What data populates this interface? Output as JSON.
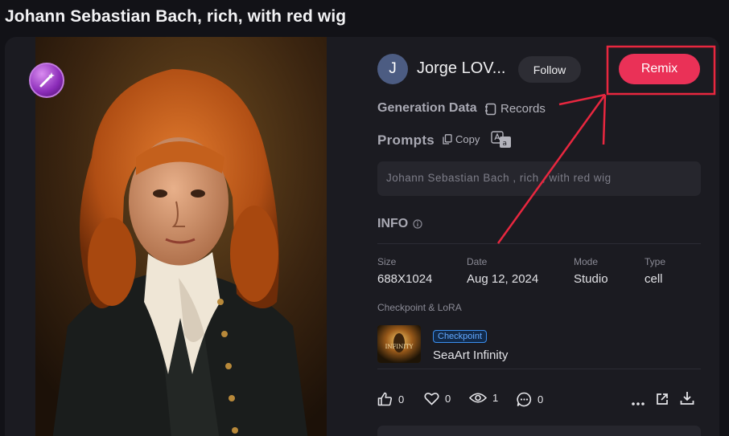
{
  "page": {
    "title": "Johann Sebastian Bach, rich, with red wig"
  },
  "artwork": {
    "badge_icon": "magic-wand-icon"
  },
  "author": {
    "initial": "J",
    "name": "Jorge LOV...",
    "follow_label": "Follow"
  },
  "actions": {
    "remix_label": "Remix"
  },
  "generation": {
    "title": "Generation Data",
    "records_label": "Records"
  },
  "prompts": {
    "title": "Prompts",
    "copy_label": "Copy",
    "text": "Johann Sebastian Bach , rich , with red wig"
  },
  "info": {
    "title": "INFO",
    "size_label": "Size",
    "size_value": "688X1024",
    "date_label": "Date",
    "date_value": "Aug 12, 2024",
    "mode_label": "Mode",
    "mode_value": "Studio",
    "type_label": "Type",
    "type_value": "cell"
  },
  "checkpoint": {
    "section_label": "Checkpoint & LoRA",
    "tag": "Checkpoint",
    "name": "SeaArt Infinity",
    "thumb_text": "INFINITY"
  },
  "stats": {
    "likes": "0",
    "favorites": "0",
    "views": "1",
    "comments": "0"
  },
  "colors": {
    "accent": "#ea3157",
    "annotation": "#e8273f",
    "tag_blue": "#3b8ff0"
  }
}
